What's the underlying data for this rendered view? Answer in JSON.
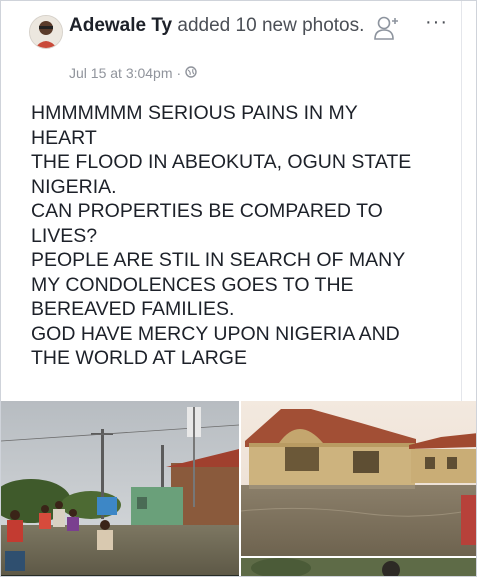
{
  "post": {
    "author": "Adewale Ty",
    "action": " added 10 new photos.",
    "timestamp": "Jul 15 at 3:04pm",
    "separator": "·",
    "privacy_icon": "globe-icon",
    "add_friend_icon": "add-friend-icon",
    "more_icon": "more-options-icon",
    "more_label": "···",
    "text_lines": [
      "HMMMMMM SERIOUS PAINS IN MY",
      "HEART",
      "THE FLOOD IN ABEOKUTA, OGUN STATE",
      "NIGERIA.",
      "CAN PROPERTIES BE COMPARED TO",
      "LIVES?",
      "PEOPLE ARE STIL IN SEARCH OF MANY",
      "MY CONDOLENCES GOES TO THE",
      "BEREAVED FAMILIES.",
      "GOD HAVE MERCY UPON NIGERIA AND",
      "THE WORLD AT LARGE"
    ]
  },
  "photos": [
    {
      "subject": "flooded-street-photo"
    },
    {
      "subject": "flooded-house-photo"
    }
  ]
}
